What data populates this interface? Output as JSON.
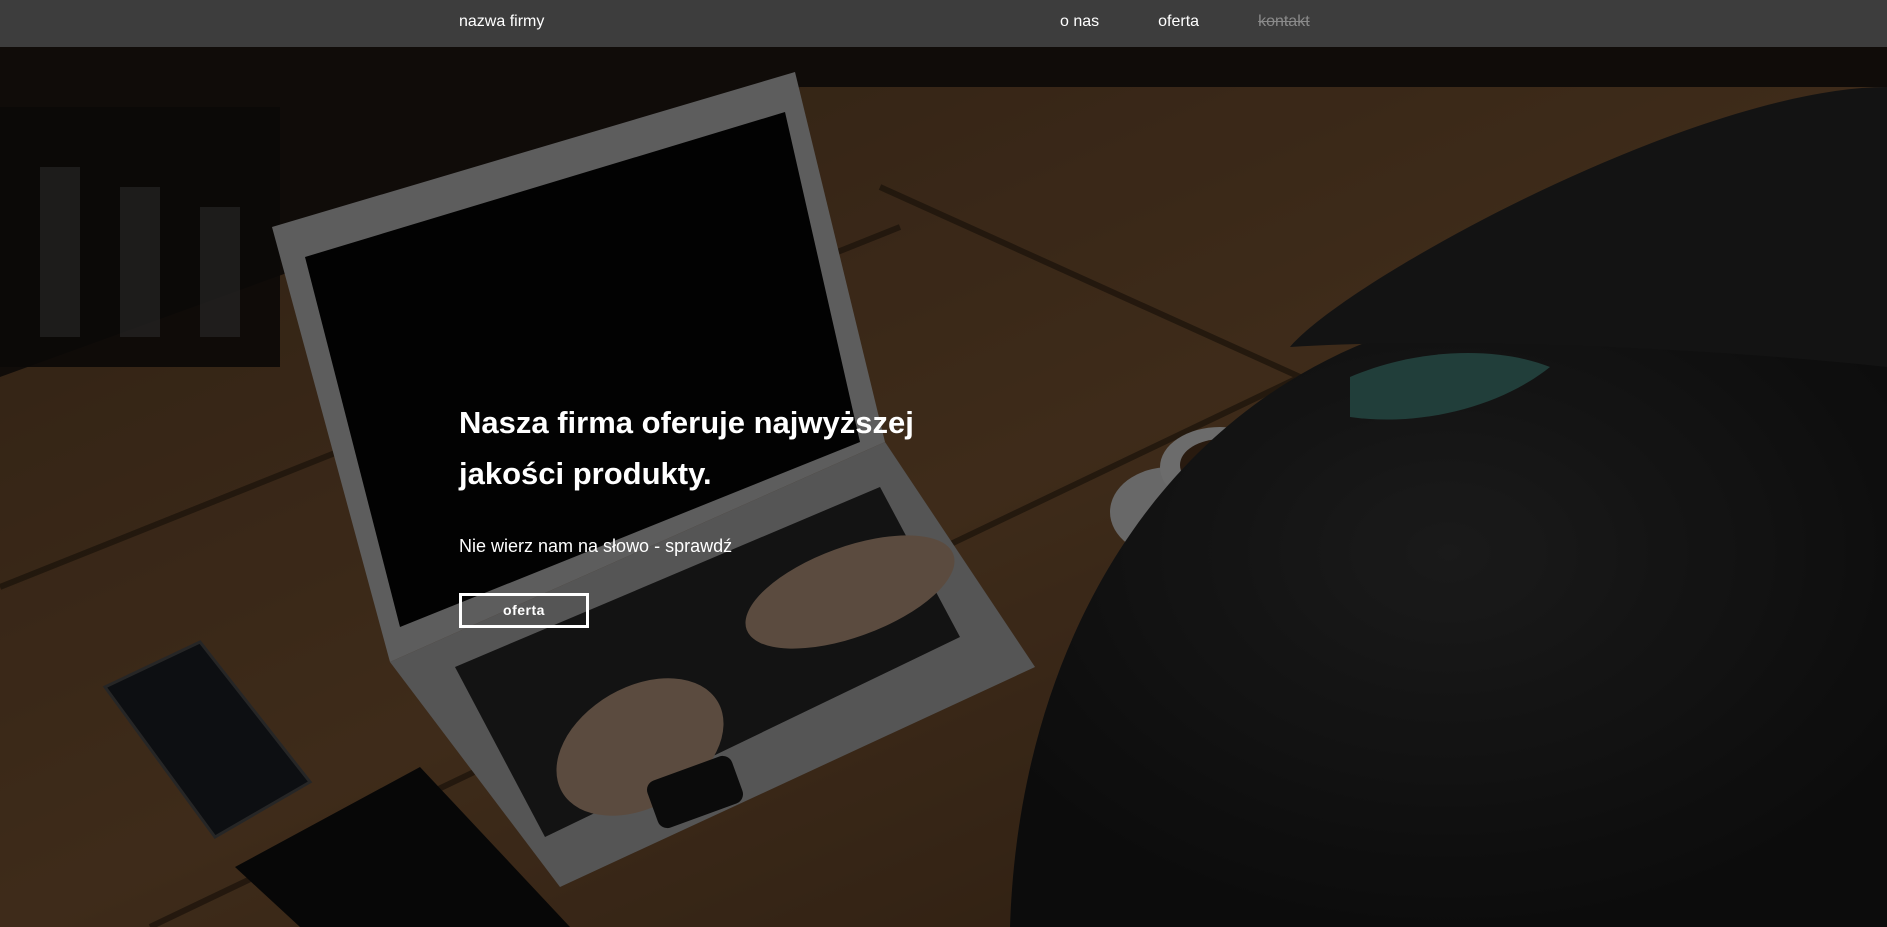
{
  "navbar": {
    "brand": "nazwa firmy",
    "links": [
      {
        "label": "o nas",
        "state": "active"
      },
      {
        "label": "oferta",
        "state": "active"
      },
      {
        "label": "kontakt",
        "state": "disabled"
      }
    ]
  },
  "hero": {
    "title": "Nasza firma oferuje najwyższej jakości produkty.",
    "subtitle": "Nie wierz nam na słowo - sprawdź",
    "button_label": "oferta",
    "background": "photo of a person typing on a laptop at a wooden table, darkened"
  },
  "colors": {
    "navbar_bg": "#3d3d3d",
    "text": "#ffffff",
    "disabled_link": "#8a8a8a",
    "overlay": "rgba(0,0,0,0.55)"
  }
}
